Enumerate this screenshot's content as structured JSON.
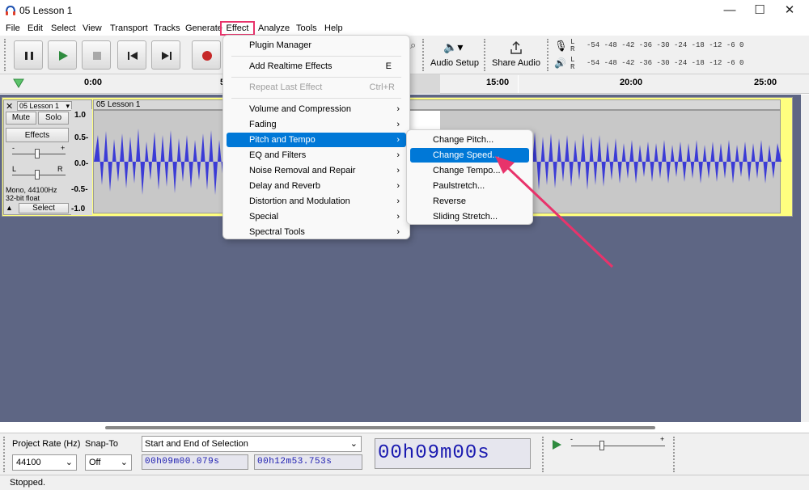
{
  "window": {
    "title": "05 Lesson 1",
    "minimize": "—",
    "maximize": "☐",
    "close": "✕"
  },
  "menubar": {
    "items": [
      "File",
      "Edit",
      "Select",
      "View",
      "Transport",
      "Tracks",
      "Generate",
      "Effect",
      "Analyze",
      "Tools",
      "Help"
    ]
  },
  "toolbar": {
    "audio_setup": "Audio Setup",
    "share_audio": "Share Audio",
    "meter_scale": "-54 -48 -42 -36 -30 -24 -18 -12 -6 0",
    "meter_l": "L",
    "meter_r": "R"
  },
  "ruler": {
    "ticks": [
      "0:00",
      "5",
      "15:00",
      "20:00",
      "25:00"
    ]
  },
  "track": {
    "name": "05 Lesson 1",
    "mute": "Mute",
    "solo": "Solo",
    "effects": "Effects",
    "gain_minus": "-",
    "gain_plus": "+",
    "pan_l": "L",
    "pan_r": "R",
    "info1": "Mono, 44100Hz",
    "info2": "32-bit float",
    "select": "Select",
    "clip_name": "05 Lesson 1",
    "scale": [
      "1.0",
      "0.5-",
      "0.0-",
      "-0.5-",
      "-1.0"
    ]
  },
  "effect_menu": {
    "items": [
      {
        "label": "Plugin Manager",
        "state": "normal"
      },
      {
        "label": "Add Realtime Effects",
        "shortcut": "E",
        "state": "normal"
      },
      {
        "label": "Repeat Last Effect",
        "shortcut": "Ctrl+R",
        "state": "disabled"
      },
      {
        "label": "Volume and Compression",
        "arrow": "›",
        "state": "normal"
      },
      {
        "label": "Fading",
        "arrow": "›",
        "state": "normal"
      },
      {
        "label": "Pitch and Tempo",
        "arrow": "›",
        "state": "selected"
      },
      {
        "label": "EQ and Filters",
        "arrow": "›",
        "state": "normal"
      },
      {
        "label": "Noise Removal and Repair",
        "arrow": "›",
        "state": "normal"
      },
      {
        "label": "Delay and Reverb",
        "arrow": "›",
        "state": "normal"
      },
      {
        "label": "Distortion and Modulation",
        "arrow": "›",
        "state": "normal"
      },
      {
        "label": "Special",
        "arrow": "›",
        "state": "normal"
      },
      {
        "label": "Spectral Tools",
        "arrow": "›",
        "state": "normal"
      }
    ]
  },
  "submenu": {
    "items": [
      {
        "label": "Change Pitch...",
        "state": "normal"
      },
      {
        "label": "Change Speed...",
        "state": "selected"
      },
      {
        "label": "Change Tempo...",
        "state": "normal"
      },
      {
        "label": "Paulstretch...",
        "state": "normal"
      },
      {
        "label": "Reverse",
        "state": "normal"
      },
      {
        "label": "Sliding Stretch...",
        "state": "normal"
      }
    ]
  },
  "bottom": {
    "project_rate_label": "Project Rate (Hz)",
    "project_rate": "44100",
    "snap_label": "Snap-To",
    "snap_value": "Off",
    "selection_mode": "Start and End of Selection",
    "start_time": "00h09m00.079s",
    "end_time": "00h12m53.753s",
    "big_time": "00h09m00s",
    "speed_minus": "-",
    "speed_plus": "+"
  },
  "status": {
    "text": "Stopped."
  },
  "colors": {
    "accent": "#e8336b",
    "selection": "#0078d7",
    "waveform": "#3b3bd6",
    "track_bg": "#5e6684"
  }
}
